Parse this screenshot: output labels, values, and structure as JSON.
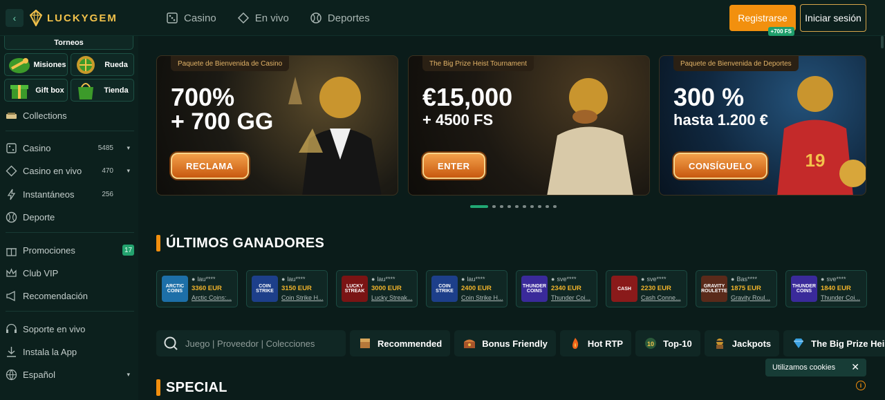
{
  "header": {
    "back_label": "‹",
    "logo_text": "LUCKYGEM",
    "nav": [
      {
        "label": "Casino",
        "icon": "dice-icon"
      },
      {
        "label": "En vivo",
        "icon": "live-chip-icon"
      },
      {
        "label": "Deportes",
        "icon": "ball-icon"
      }
    ],
    "register_label": "Registrarse",
    "register_badge": "+700 FS",
    "login_label": "Iniciar sesión"
  },
  "sidebar": {
    "top_tile": "Torneos",
    "tiles": [
      {
        "label": "Misiones"
      },
      {
        "label": "Rueda"
      },
      {
        "label": "Gift box"
      },
      {
        "label": "Tienda"
      }
    ],
    "collections": "Collections",
    "items": [
      {
        "label": "Casino",
        "count": "5485",
        "caret": "▾"
      },
      {
        "label": "Casino en vivo",
        "count": "470",
        "caret": "▾"
      },
      {
        "label": "Instantáneos",
        "count": "256"
      },
      {
        "label": "Deporte"
      }
    ],
    "items2": [
      {
        "label": "Promociones",
        "badge": "17"
      },
      {
        "label": "Club VIP"
      },
      {
        "label": "Recomendación"
      }
    ],
    "items3": [
      {
        "label": "Soporte en vivo"
      },
      {
        "label": "Instala la App"
      },
      {
        "label": "Español",
        "caret": "▾"
      }
    ]
  },
  "banners": [
    {
      "tag": "Paquete de Bienvenida de Casino",
      "title": "700%",
      "sub": "+ 700 GG",
      "button": "RECLAMA"
    },
    {
      "tag": "The Big Prize Heist Tournament",
      "title": "€15,000",
      "sub": "+ 4500 FS",
      "button": "ENTER"
    },
    {
      "tag": "Paquete de Bienvenida de Deportes",
      "title": "300 %",
      "sub": "hasta 1.200 €",
      "button": "CONSÍGUELO"
    }
  ],
  "carousel": {
    "total": 10,
    "active": 0
  },
  "winners_title": "ÚLTIMOS GANADORES",
  "winners": [
    {
      "user": "lau****",
      "amount": "3360 EUR",
      "game": "Arctic Coins:...",
      "thumb": "ARCTIC COINS",
      "color": "#1d6fa8"
    },
    {
      "user": "lau****",
      "amount": "3150 EUR",
      "game": "Coin Strike H...",
      "thumb": "COIN STRIKE",
      "color": "#1d3f8a"
    },
    {
      "user": "lau****",
      "amount": "3000 EUR",
      "game": "Lucky Streak...",
      "thumb": "LUCKY STREAK",
      "color": "#7a1414"
    },
    {
      "user": "lau****",
      "amount": "2400 EUR",
      "game": "Coin Strike H...",
      "thumb": "COIN STRIKE",
      "color": "#1d3f8a"
    },
    {
      "user": "sve****",
      "amount": "2340 EUR",
      "game": "Thunder Coi...",
      "thumb": "THUNDER COINS",
      "color": "#3a2a9a"
    },
    {
      "user": "sve****",
      "amount": "2230 EUR",
      "game": "Cash Conne...",
      "thumb": "CASH",
      "color": "#8a1a1a"
    },
    {
      "user": "Bas****",
      "amount": "1875 EUR",
      "game": "Gravity Roul...",
      "thumb": "GRAVITY ROULETTE",
      "color": "#5a2a1a"
    },
    {
      "user": "sve****",
      "amount": "1840 EUR",
      "game": "Thunder Coi...",
      "thumb": "THUNDER COINS",
      "color": "#3a2a9a"
    }
  ],
  "search": {
    "placeholder": "Juego | Proveedor | Colecciones"
  },
  "filters": [
    {
      "label": "Recommended",
      "icon": "chest-icon"
    },
    {
      "label": "Bonus Friendly",
      "icon": "treasure-icon"
    },
    {
      "label": "Hot RTP",
      "icon": "flame-icon"
    },
    {
      "label": "Top-10",
      "icon": "top10-icon"
    },
    {
      "label": "Jackpots",
      "icon": "thief-icon"
    },
    {
      "label": "The Big Prize Heist T",
      "icon": "diamond-icon"
    }
  ],
  "special_title": "SPECIAL",
  "cookie": {
    "text": "Utilizamos cookies",
    "close": "✕"
  },
  "info": "i",
  "colors": {
    "accent": "#f28e0e",
    "brand": "#f3c24b",
    "green": "#21a874",
    "bg": "#0b1c1a"
  }
}
